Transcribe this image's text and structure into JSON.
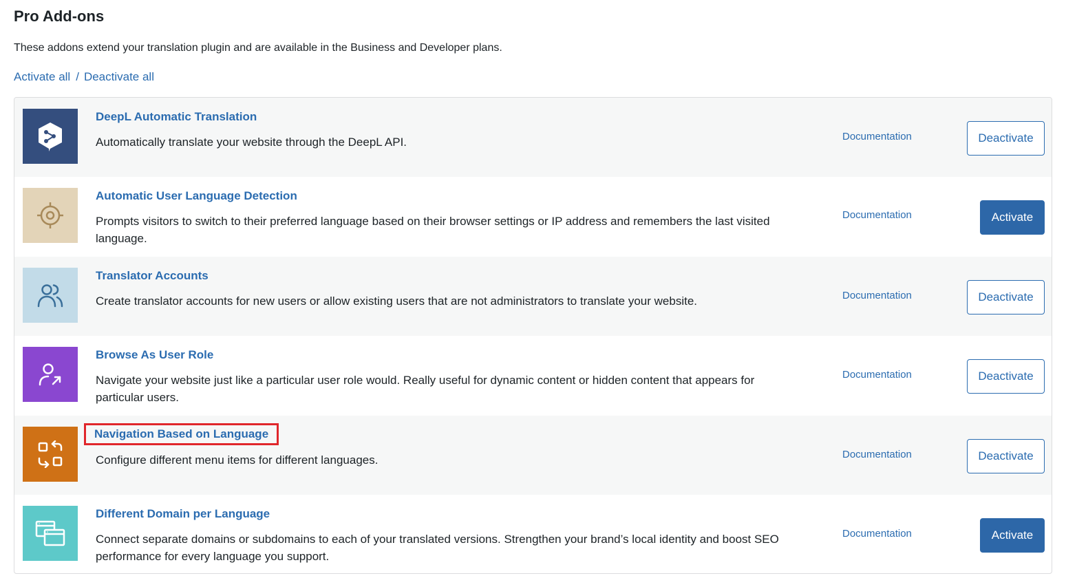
{
  "header": {
    "title": "Pro Add-ons",
    "description": "These addons extend your translation plugin and are available in the Business and Developer plans.",
    "activate_all": "Activate all",
    "separator": "/",
    "deactivate_all": "Deactivate all"
  },
  "addons": [
    {
      "name": "DeepL Automatic Translation",
      "description": "Automatically translate your website through the DeepL API.",
      "doc_label": "Documentation",
      "button_label": "Deactivate",
      "icon": "deepl-logo-icon",
      "icon_bg": "#344e7e"
    },
    {
      "name": "Automatic User Language Detection",
      "description": "Prompts visitors to switch to their preferred language based on their browser settings or IP address and remembers the last visited language.",
      "doc_label": "Documentation",
      "button_label": "Activate",
      "icon": "target-icon",
      "icon_bg": "#e3d4b8"
    },
    {
      "name": "Translator Accounts",
      "description": "Create translator accounts for new users or allow existing users that are not administrators to translate your website.",
      "doc_label": "Documentation",
      "button_label": "Deactivate",
      "icon": "users-icon",
      "icon_bg": "#c2dbe8"
    },
    {
      "name": "Browse As User Role",
      "description": "Navigate your website just like a particular user role would. Really useful for dynamic content or hidden content that appears for particular users.",
      "doc_label": "Documentation",
      "button_label": "Deactivate",
      "icon": "user-arrow-icon",
      "icon_bg": "#8a47d0"
    },
    {
      "name": "Navigation Based on Language",
      "description": "Configure different menu items for different languages.",
      "doc_label": "Documentation",
      "button_label": "Deactivate",
      "icon": "navigation-swap-icon",
      "icon_bg": "#cf7116"
    },
    {
      "name": "Different Domain per Language",
      "description": "Connect separate domains or subdomains to each of your translated versions. Strengthen your brand’s local identity and boost SEO performance for every language you support.",
      "doc_label": "Documentation",
      "button_label": "Activate",
      "icon": "browser-windows-icon",
      "icon_bg": "#5dc9c9"
    }
  ],
  "colors": {
    "link": "#2b6cb0",
    "primary_button": "#2d67a8",
    "highlight_box": "#e0262b",
    "alt_row": "#f6f7f7"
  }
}
